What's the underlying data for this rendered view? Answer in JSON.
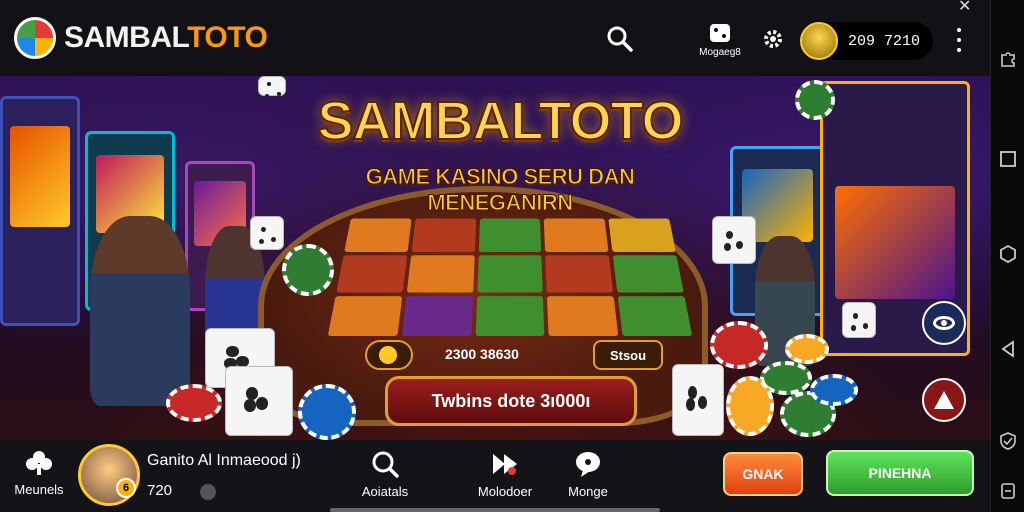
{
  "header": {
    "logo_text_a": "SAMBAL",
    "logo_text_b": "TOTO",
    "games_label": "Mogaeg8",
    "balance": "209 7210"
  },
  "banner": {
    "title": "SAMBALTOTO",
    "subtitle": "GAME KASINO SERU DAN MENEGANIRN",
    "info_numbers": "2300 38630",
    "info_tag": "Stsou",
    "cta_label": "Twbins dote 3ı000ı"
  },
  "bottom": {
    "menu_label": "Meunels",
    "player_name": "Ganito Al Inmaeood j)",
    "player_level": "720",
    "player_badge": "6",
    "actions_label": "Aoiatals",
    "modes_label": "Molodoer",
    "more_label": "Monge",
    "orange_button": "GNAK",
    "green_button": "PINEHNA"
  },
  "colors": {
    "accent_orange": "#ff9800",
    "cta_green": "#3fc23a",
    "cta_orange": "#f06020",
    "bg_dark": "#121216"
  }
}
